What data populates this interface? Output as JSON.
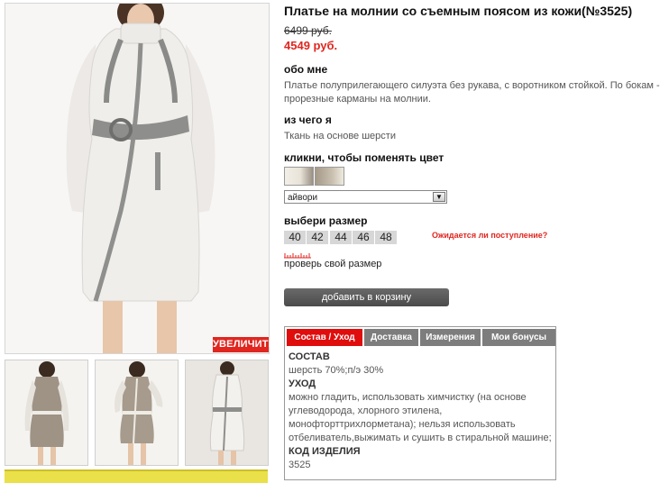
{
  "product": {
    "title": "Платье на молнии со съемным поясом из кожи(№3525)",
    "old_price": "6499 руб.",
    "new_price": "4549 руб."
  },
  "gallery": {
    "zoom_label": "УВЕЛИЧИТЬ"
  },
  "about": {
    "heading": "обо мне",
    "text": "Платье полуприлегающего силуэта без рукава, с воротником стойкой. По бокам - прорезные карманы на молнии."
  },
  "material": {
    "heading": "из чего я",
    "text": "Ткань на основе шерсти"
  },
  "color": {
    "heading": "кликни, чтобы поменять цвет",
    "selected": "айвори"
  },
  "size": {
    "heading": "выбери размер",
    "options": [
      "40",
      "42",
      "44",
      "46",
      "48"
    ],
    "expected_link": "Ожидается ли поступление?",
    "check_size_link": "проверь свой размер"
  },
  "cart": {
    "add_label": "добавить в корзину"
  },
  "tabs": {
    "items": [
      "Состав / Уход",
      "Доставка",
      "Измерения",
      "Мои бонусы"
    ],
    "active": "Состав / Уход"
  },
  "composition": {
    "composition_heading": "СОСТАВ",
    "composition_text": "шерсть 70%;п/э 30%",
    "care_heading": "УХОД",
    "care_text": "можно гладить, использовать химчистку (на основе углеводорода, хлорного этилена, монофторттрихлорметана); нельзя использовать отбеливатель,выжимать и сушить в стиральной машине;",
    "code_heading": "КОД ИЗДЕЛИЯ",
    "code_value": "3525"
  },
  "colors": {
    "accent": "#e0261f",
    "tab_active": "#e00d0d",
    "tab_inactive": "#7d7d7d",
    "button": "#555555"
  }
}
